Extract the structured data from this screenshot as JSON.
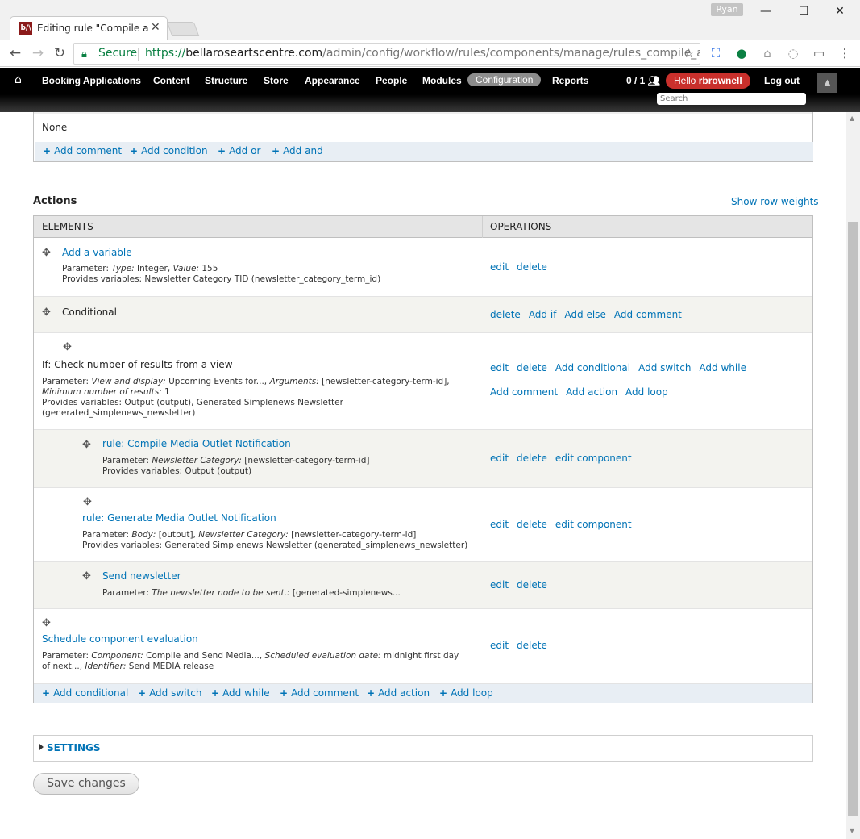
{
  "browser": {
    "tab_title": "Editing rule \"Compile and Send Media...",
    "favicon_text": "b/\\",
    "profile_name": "Ryan",
    "secure_label": "Secure",
    "url_scheme": "https://",
    "url_host": "bellaroseartscentre.com",
    "url_path": "/admin/config/workflow/rules/components/manage/rules_compile_and_sen",
    "icons": [
      "back-icon",
      "forward-icon",
      "reload-icon",
      "lock-icon",
      "star-icon",
      "menu-icon"
    ]
  },
  "admin_menu": {
    "items": [
      "Booking Applications",
      "Content",
      "Structure",
      "Store",
      "Appearance",
      "People",
      "Modules",
      "Configuration",
      "Reports"
    ],
    "active": "Configuration",
    "user_count": "0 / 1",
    "hello_prefix": "Hello",
    "username": "rbrownell",
    "logout": "Log out",
    "search_placeholder": "Search"
  },
  "conditions": {
    "none_text": "None",
    "add_links": [
      "Add comment",
      "Add condition",
      "Add or",
      "Add and"
    ]
  },
  "actions": {
    "title": "Actions",
    "show_row_weights": "Show row weights",
    "col_elements": "ELEMENTS",
    "col_operations": "OPERATIONS",
    "rows": [
      {
        "title": "Add a variable",
        "line1_label1": "Parameter: ",
        "line1_key1": "Type:",
        "line1_val1": " Integer, ",
        "line1_key2": "Value:",
        "line1_val2": " 155",
        "line2": "Provides variables: Newsletter Category TID (newsletter_category_term_id)",
        "ops": [
          "edit",
          "delete"
        ]
      },
      {
        "title": "Conditional",
        "ops": [
          "delete",
          "Add if",
          "Add else",
          "Add comment"
        ]
      },
      {
        "title": "If: Check number of results from a view",
        "line1_label1": "Parameter: ",
        "line1_key1": "View and display:",
        "line1_val1": " Upcoming Events for..., ",
        "line1_key2": "Arguments:",
        "line1_val2": " [newsletter-category-term-id],",
        "line2_key": "Minimum number of results:",
        "line2_val": " 1",
        "line3": "Provides variables: Output (output), Generated Simplenews Newsletter",
        "line4": "(generated_simplenews_newsletter)",
        "ops": [
          "edit",
          "delete",
          "Add conditional",
          "Add switch",
          "Add while"
        ],
        "ops2": [
          "Add comment",
          "Add action",
          "Add loop"
        ]
      },
      {
        "title": "rule: Compile Media Outlet Notification",
        "line1_label1": "Parameter: ",
        "line1_key1": "Newsletter Category:",
        "line1_val1": " [newsletter-category-term-id]",
        "line2": "Provides variables: Output (output)",
        "ops": [
          "edit",
          "delete",
          "edit component"
        ]
      },
      {
        "title": "rule: Generate Media Outlet Notification",
        "line1_label1": "Parameter: ",
        "line1_key1": "Body:",
        "line1_val1": " [output], ",
        "line1_key2": "Newsletter Category:",
        "line1_val2": " [newsletter-category-term-id]",
        "line2": "Provides variables: Generated Simplenews Newsletter (generated_simplenews_newsletter)",
        "ops": [
          "edit",
          "delete",
          "edit component"
        ]
      },
      {
        "title": "Send newsletter",
        "line1_label1": "Parameter: ",
        "line1_key1": "The newsletter node to be sent.:",
        "line1_val1": " [generated-simplenews...",
        "ops": [
          "edit",
          "delete"
        ]
      },
      {
        "title": "Schedule component evaluation",
        "line1_label1": "Parameter: ",
        "line1_key1": "Component:",
        "line1_val1": " Compile and Send Media..., ",
        "line1_key2": "Scheduled evaluation date:",
        "line1_val2": " midnight first day",
        "line2_pre": "of next..., ",
        "line2_key": "Identifier:",
        "line2_val": " Send MEDIA release",
        "ops": [
          "edit",
          "delete"
        ]
      }
    ],
    "add_links": [
      "Add conditional",
      "Add switch",
      "Add while",
      "Add comment",
      "Add action",
      "Add loop"
    ]
  },
  "settings_label": "SETTINGS",
  "save_button": "Save changes"
}
